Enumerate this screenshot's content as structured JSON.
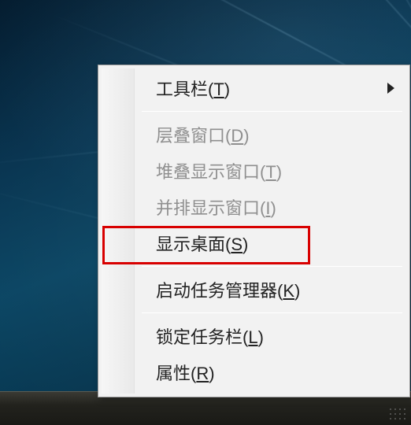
{
  "menu": {
    "items": [
      {
        "text": "工具栏",
        "accel": "T",
        "has_submenu": true,
        "enabled": true
      },
      {
        "text": "层叠窗口",
        "accel": "D",
        "has_submenu": false,
        "enabled": false
      },
      {
        "text": "堆叠显示窗口",
        "accel": "T",
        "has_submenu": false,
        "enabled": false
      },
      {
        "text": "并排显示窗口",
        "accel": "I",
        "has_submenu": false,
        "enabled": false
      },
      {
        "text": "显示桌面",
        "accel": "S",
        "has_submenu": false,
        "enabled": true
      },
      {
        "text": "启动任务管理器",
        "accel": "K",
        "has_submenu": false,
        "enabled": true
      },
      {
        "text": "锁定任务栏",
        "accel": "L",
        "has_submenu": false,
        "enabled": true
      },
      {
        "text": "属性",
        "accel": "R",
        "has_submenu": false,
        "enabled": true
      }
    ]
  },
  "annotation": {
    "highlight_index": 4,
    "color": "#d80000"
  }
}
